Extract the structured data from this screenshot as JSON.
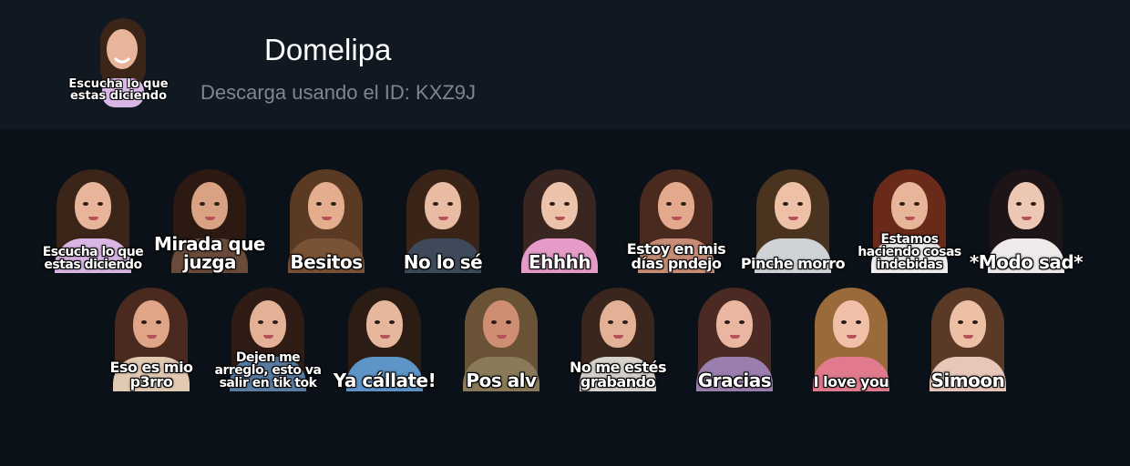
{
  "pack": {
    "title": "Domelipa",
    "download_text": "Descarga usando el ID: KXZ9J",
    "thumb_caption": "Escucha lo que estas diciendo"
  },
  "stickers": [
    {
      "caption": "Escucha lo que estas diciendo",
      "hair": "#3b2418",
      "skin": "#e9b59a",
      "shirt": "#d9b6e6"
    },
    {
      "caption": "Mirada que juzga",
      "hair": "#2c1a12",
      "skin": "#d9a283",
      "shirt": "#6a4a3a"
    },
    {
      "caption": "Besitos",
      "hair": "#5a3a22",
      "skin": "#e4ad8e",
      "shirt": "#7a5236"
    },
    {
      "caption": "No lo sé",
      "hair": "#3a2418",
      "skin": "#e8bba2",
      "shirt": "#3e4a5a"
    },
    {
      "caption": "Ehhhh",
      "hair": "#3a2620",
      "skin": "#edc2aa",
      "shirt": "#e59ac7"
    },
    {
      "caption": "Estoy en mis días pndejo",
      "hair": "#4a2a1e",
      "skin": "#e3a98c",
      "shirt": "#c78d76"
    },
    {
      "caption": "Pinche morro",
      "hair": "#4a3420",
      "skin": "#eec1a6",
      "shirt": "#cfd3d6"
    },
    {
      "caption": "Estamos haciendo cosas indebidas",
      "hair": "#6a2a1a",
      "skin": "#e6b59a",
      "shirt": "#f2eeee"
    },
    {
      "caption": "*Modo sad*",
      "hair": "#1c1416",
      "skin": "#ecc7b4",
      "shirt": "#f0e9ea"
    },
    {
      "caption": "Eso es mio p3rro",
      "hair": "#4a2a1e",
      "skin": "#dfa586",
      "shirt": "#e1c9b2"
    },
    {
      "caption": "Dejen me arreglo, esto va salir en tik tok",
      "hair": "#2f1c14",
      "skin": "#e5b196",
      "shirt": "#5a7ea3"
    },
    {
      "caption": "Ya cállate!",
      "hair": "#2b1c14",
      "skin": "#e6b79d",
      "shirt": "#5e94c8"
    },
    {
      "caption": "Pos alv",
      "hair": "#6a5236",
      "skin": "#cf8d72",
      "shirt": "#8a7a5a"
    },
    {
      "caption": "No me estés grabando",
      "hair": "#3a261c",
      "skin": "#e2b196",
      "shirt": "#d8d2cc"
    },
    {
      "caption": "Gracias",
      "hair": "#4a2a22",
      "skin": "#e9b7a0",
      "shirt": "#9a7fae"
    },
    {
      "caption": "I love you",
      "hair": "#9a6a3a",
      "skin": "#f0c1a8",
      "shirt": "#e07a8c"
    },
    {
      "caption": "Simoon",
      "hair": "#5a3a26",
      "skin": "#edc0a6",
      "shirt": "#e6c7b9"
    }
  ]
}
